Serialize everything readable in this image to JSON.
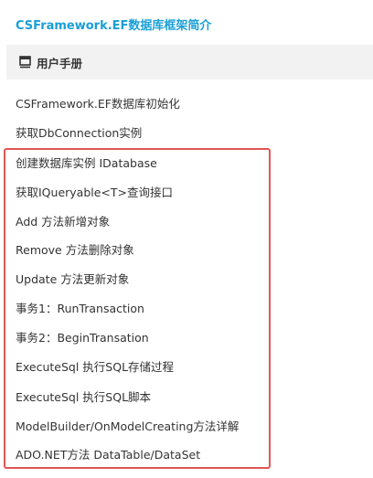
{
  "site": {
    "title": "CSFramework.EF数据库框架简介"
  },
  "section": {
    "icon": "book-icon",
    "label": "用户手册"
  },
  "nav": {
    "items": [
      {
        "label": "CSFramework.EF数据库初始化"
      },
      {
        "label": "获取DbConnection实例"
      },
      {
        "label": "创建数据库实例 IDatabase"
      },
      {
        "label": "获取IQueryable<T>查询接口"
      },
      {
        "label": "Add 方法新增对象"
      },
      {
        "label": "Remove 方法删除对象"
      },
      {
        "label": "Update 方法更新对象"
      },
      {
        "label": "事务1：RunTransaction"
      },
      {
        "label": "事务2：BeginTransation"
      },
      {
        "label": "ExecuteSql 执行SQL存储过程"
      },
      {
        "label": "ExecuteSql 执行SQL脚本"
      },
      {
        "label": "ModelBuilder/OnModelCreating方法详解"
      },
      {
        "label": "ADO.NET方法 DataTable/DataSet"
      }
    ]
  },
  "colors": {
    "title": "#1a9fd6",
    "header_bg": "#f2f2f2",
    "highlight_border": "#e25555",
    "text": "#333333"
  }
}
